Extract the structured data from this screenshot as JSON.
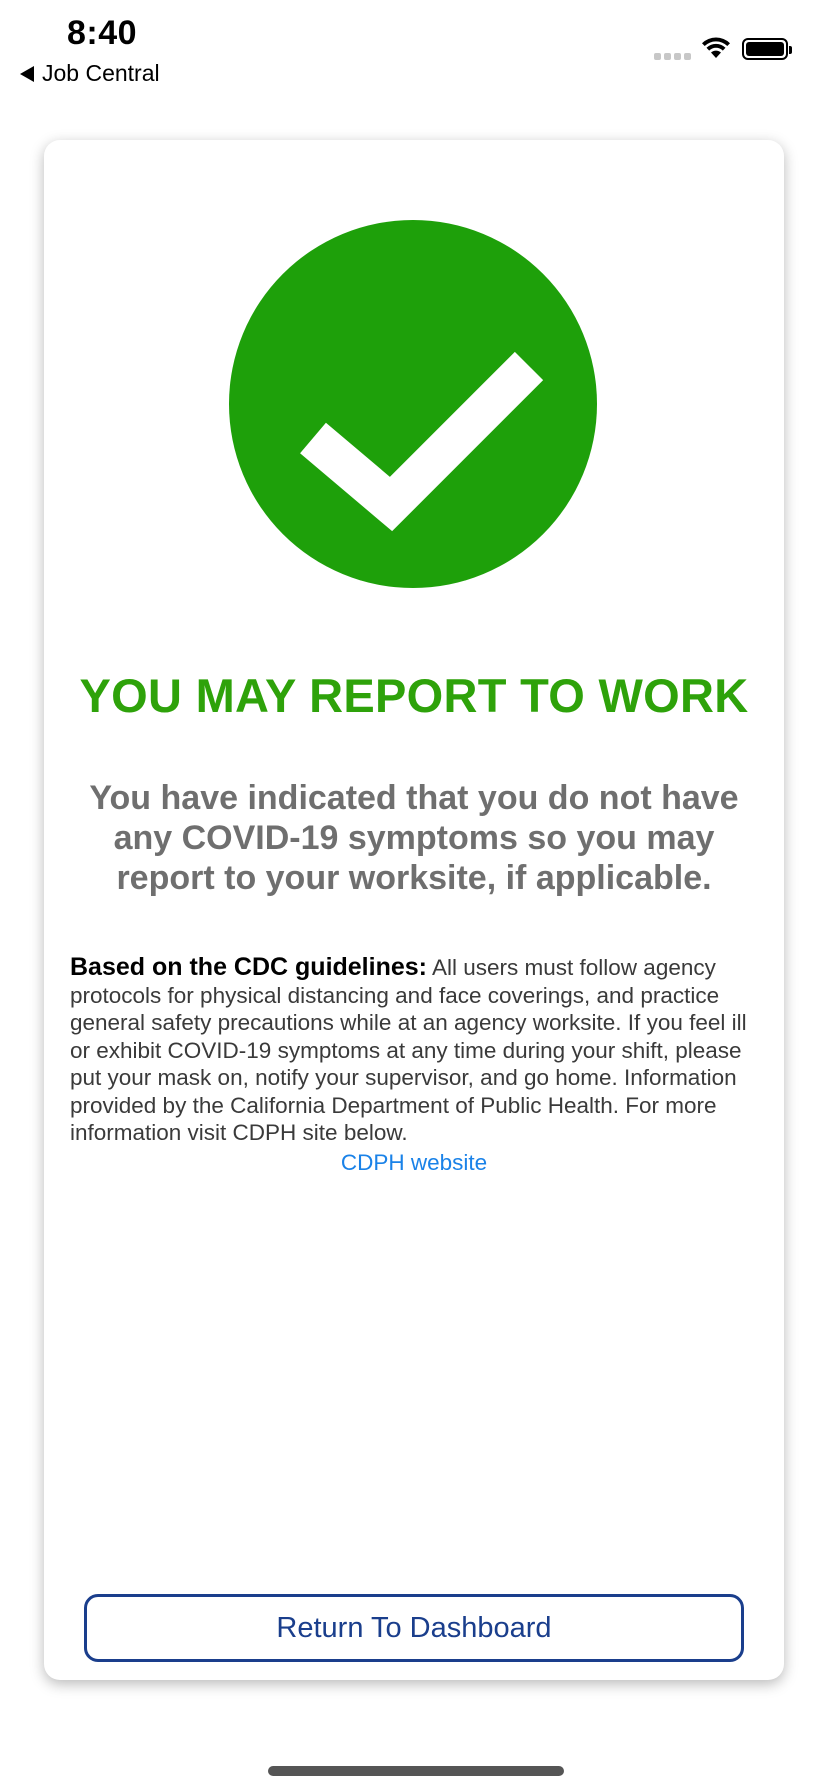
{
  "status_bar": {
    "time": "8:40",
    "back_label": "Job Central",
    "icons": [
      "signal-icon",
      "wifi-icon",
      "battery-icon"
    ]
  },
  "card": {
    "icon": "checkmark-circle-icon",
    "headline": "YOU MAY REPORT TO WORK",
    "subtext": "You have indicated that you do not have any COVID-19 symptoms so you may report to your worksite, if applicable.",
    "guidelines_title": "Based on the CDC guidelines:",
    "guidelines_body": " All users must follow agency protocols for physical distancing and face coverings, and practice general safety precautions while at an agency worksite. If you feel ill or exhibit COVID-19 symptoms at any time during your shift, please put your mask on, notify your supervisor, and go home. Information provided by the California Department of Public Health. For more information visit CDPH site below.",
    "link_label": "CDPH website",
    "button_label": "Return To Dashboard"
  },
  "colors": {
    "success_green": "#1ea00a",
    "headline_green": "#2ea20a",
    "link_blue": "#1a82e8",
    "button_navy": "#1a3e8c",
    "subtext_gray": "#6f6f6f"
  }
}
